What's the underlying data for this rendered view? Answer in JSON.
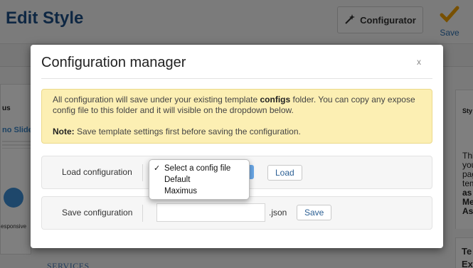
{
  "page": {
    "title": "Edit Style",
    "configurator_label": "Configurator",
    "save_label": "Save",
    "left_panel": {
      "heading_fragment": "us",
      "slide_fragment": "no Slide He",
      "responsive_fragment": "esponsive"
    },
    "services_label": "SERVICES",
    "right_panel": {
      "heading_fragment": "Sty",
      "text_lines": [
        "Thi",
        "you",
        "pag",
        "tem",
        "as",
        "Me",
        "As"
      ],
      "bottom_lines": [
        "Te",
        "Ex"
      ]
    }
  },
  "modal": {
    "title": "Configuration manager",
    "close_label": "x",
    "alert": {
      "text_before": "All configuration will save under your existing template ",
      "bold_word": "configs",
      "text_after": " folder. You can copy any expose config file to this folder and it will visible on the dropdown below.",
      "note_label": "Note:",
      "note_text": " Save template settings first before saving the configuration."
    },
    "load": {
      "label": "Load configuration",
      "button_label": "Load",
      "options": [
        "Select a config file",
        "Default",
        "Maximus"
      ],
      "selected_option": "Select a config file",
      "checkmark": "✓"
    },
    "save": {
      "label": "Save configuration",
      "input_value": "",
      "input_placeholder": "",
      "suffix": ".json",
      "button_label": "Save"
    }
  },
  "colors": {
    "title_blue": "#1d4f86",
    "alert_bg": "#fcefb3",
    "save_icon_orange": "#f0a000",
    "button_text_blue": "#2b5f94"
  },
  "icons": [
    "wand-icon",
    "checkmark-save-icon",
    "close-icon",
    "check-icon"
  ]
}
